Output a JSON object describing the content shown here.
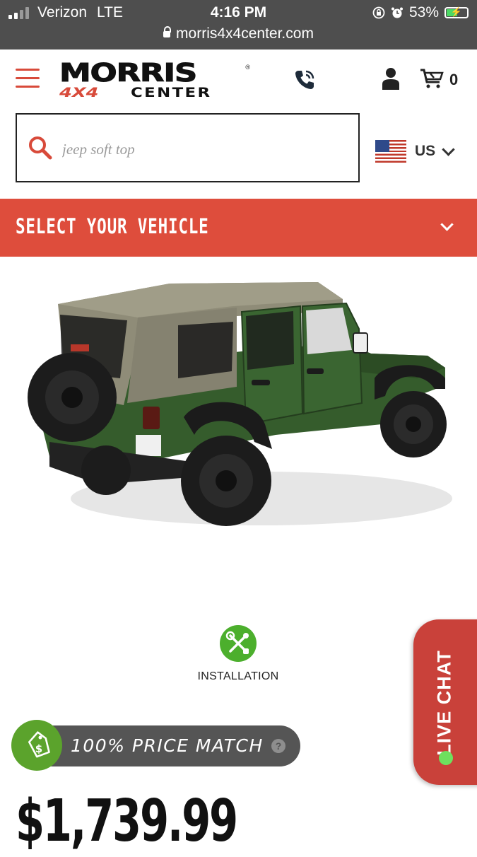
{
  "status_bar": {
    "carrier": "Verizon",
    "network": "LTE",
    "time": "4:16 PM",
    "battery": "53%",
    "url": "morris4x4center.com"
  },
  "header": {
    "logo_top": "MORRIS",
    "logo_4x4": "4X4",
    "logo_center": "CENTER",
    "cart_count": "0"
  },
  "search": {
    "placeholder": "jeep soft top"
  },
  "region": {
    "label": "US"
  },
  "vehicle_selector": {
    "label": "SELECT YOUR VEHICLE"
  },
  "product": {
    "installation_label": "INSTALLATION",
    "price_match_label": "100% PRICE MATCH",
    "price_match_help": "?",
    "price": "$1,739.99"
  },
  "live_chat": {
    "label": "LIVE CHAT"
  },
  "colors": {
    "accent_red": "#de4d3c",
    "green": "#4caf2d",
    "dark_gray": "#555555"
  }
}
